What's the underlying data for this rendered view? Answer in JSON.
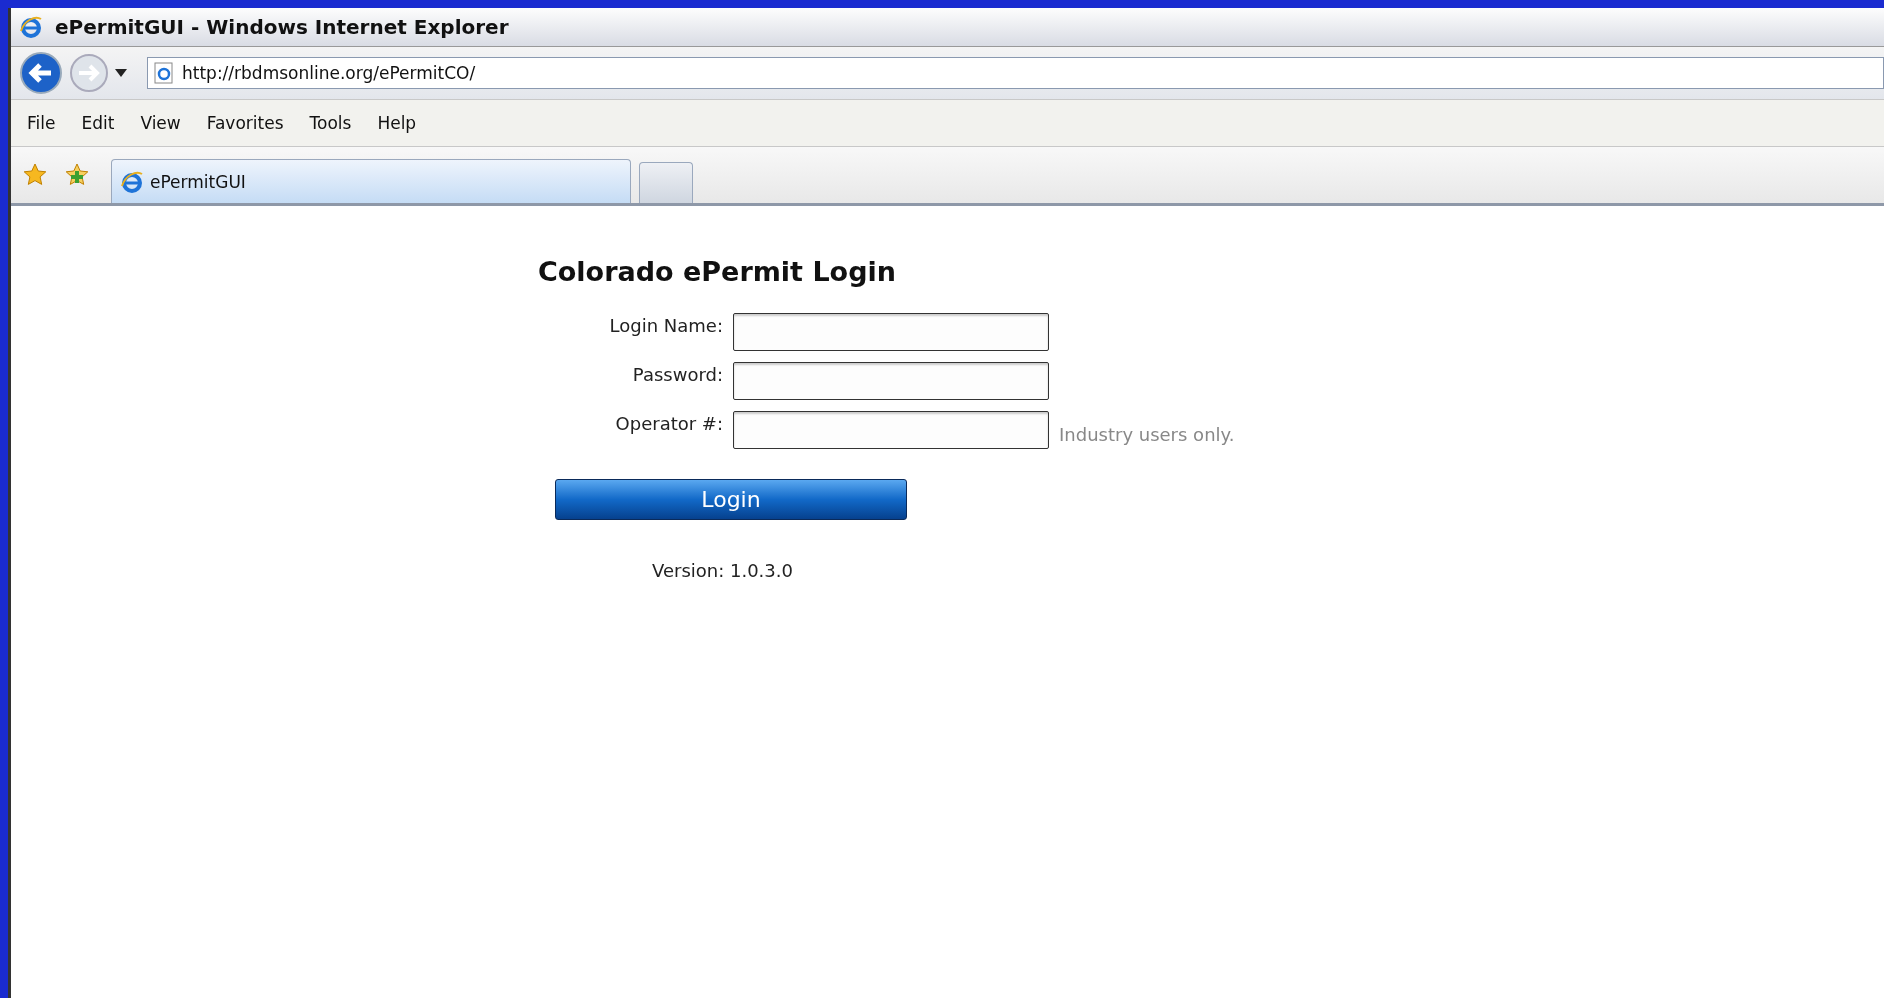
{
  "window": {
    "title": "ePermitGUI - Windows Internet Explorer"
  },
  "address_bar": {
    "url": "http://rbdmsonline.org/ePermitCO/"
  },
  "menu": [
    "File",
    "Edit",
    "View",
    "Favorites",
    "Tools",
    "Help"
  ],
  "tabs": [
    {
      "label": "ePermitGUI",
      "selected": true
    }
  ],
  "login_form": {
    "title": "Colorado ePermit Login",
    "fields": [
      {
        "label": "Login Name:"
      },
      {
        "label": "Password:"
      },
      {
        "label": "Operator #:",
        "hint": "Industry users only."
      }
    ],
    "button": "Login",
    "version": "Version: 1.0.3.0"
  }
}
